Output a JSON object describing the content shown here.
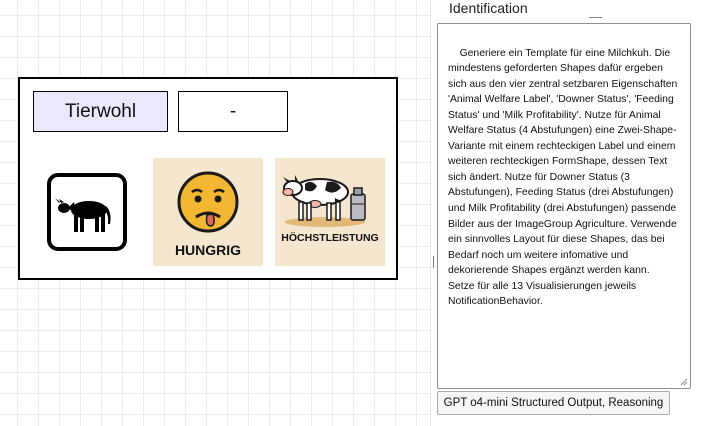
{
  "canvas": {
    "label_text": "Tierwohl",
    "value_text": "-",
    "images": [
      {
        "icon": "cow-icon",
        "caption": ""
      },
      {
        "icon": "hungry-face-icon",
        "caption": "HUNGRIG"
      },
      {
        "icon": "dairy-cow-milk-can-icon",
        "caption": "HÖCHSTLEISTUNG"
      }
    ]
  },
  "panel": {
    "title": "Identification",
    "prompt_text": "Generiere ein Template für eine Milchkuh. Die mindestens geforderten Shapes dafür ergeben sich aus den vier zentral setzbaren Eigenschaften 'Animal Welfare Label', 'Downer Status', 'Feeding Status' und 'Milk Profitability'. Nutze für Animal Welfare Status (4 Abstufungen) eine Zwei-Shape-Variante mit einem rechteckigen Label und einem weiteren rechteckigen FormShape, dessen Text sich ändert. Nutze für Downer Status (3 Abstufungen), Feeding Status (drei Abstufungen) und Milk Profitability (drei Abstufungen) passende Bilder aus der ImageGroup Agriculture. Verwende ein sinnvolles Layout für diese Shapes, das bei Bedarf noch um weitere infomative und dekorierende Shapes ergänzt werden kann. Setze für alle 13 Visualisierungen jeweils NotificationBehavior.",
    "button_label": "GPT o4-mini Structured Output, Reasoning"
  }
}
